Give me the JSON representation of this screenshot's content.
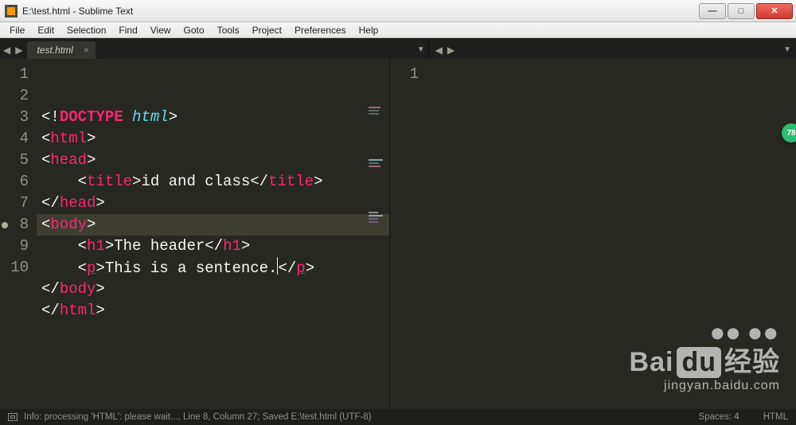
{
  "window": {
    "title": "E:\\test.html - Sublime Text",
    "buttons": {
      "min": "—",
      "max": "□",
      "close": "✕"
    }
  },
  "menu": [
    "File",
    "Edit",
    "Selection",
    "Find",
    "View",
    "Goto",
    "Tools",
    "Project",
    "Preferences",
    "Help"
  ],
  "tabs": {
    "left_nav": {
      "back": "◀",
      "fwd": "▶"
    },
    "items": [
      {
        "label": "test.html",
        "close": "×"
      }
    ],
    "split_left_arrow": "▼",
    "right_nav": {
      "back": "◀",
      "fwd": "▶"
    },
    "split_right_arrow": "▼"
  },
  "editor": {
    "left_pane": {
      "line_numbers": [
        "1",
        "2",
        "3",
        "4",
        "5",
        "6",
        "7",
        "8",
        "9",
        "10"
      ],
      "active_line_index": 7,
      "modified_line_index": 7,
      "lines": {
        "l1": {
          "open": "<!",
          "doctype": "DOCTYPE",
          "sp": " ",
          "kw": "html",
          "close": ">"
        },
        "l2": {
          "open": "<",
          "tag": "html",
          "close": ">"
        },
        "l3": {
          "open": "<",
          "tag": "head",
          "close": ">"
        },
        "l4": {
          "indent": "    ",
          "open": "<",
          "tag": "title",
          "close1": ">",
          "text": "id and class",
          "open2": "</",
          "tag2": "title",
          "close2": ">"
        },
        "l5": {
          "open": "</",
          "tag": "head",
          "close": ">"
        },
        "l6": {
          "open": "<",
          "tag": "body",
          "close": ">"
        },
        "l7": {
          "indent": "    ",
          "open": "<",
          "tag": "h1",
          "close1": ">",
          "text": "The header",
          "open2": "</",
          "tag2": "h1",
          "close2": ">"
        },
        "l8": {
          "indent": "    ",
          "open": "<",
          "tag": "p",
          "close1": ">",
          "text": "This is a sentence.",
          "open2": "</",
          "tag2": "p",
          "close2": ">"
        },
        "l9": {
          "open": "</",
          "tag": "body",
          "close": ">"
        },
        "l10": {
          "open": "</",
          "tag": "html",
          "close": ">"
        }
      }
    },
    "right_pane": {
      "line_numbers": [
        "1"
      ]
    }
  },
  "status": {
    "msg": "Info: processing 'HTML': please wait..., Line 8, Column 27; Saved E:\\test.html (UTF-8)",
    "spaces": "Spaces: 4",
    "syntax": "HTML"
  },
  "watermark": {
    "line1a": "Bai",
    "line1b": "du",
    "line1c": "经验",
    "line2": "jingyan.baidu.com"
  },
  "badge": "78"
}
